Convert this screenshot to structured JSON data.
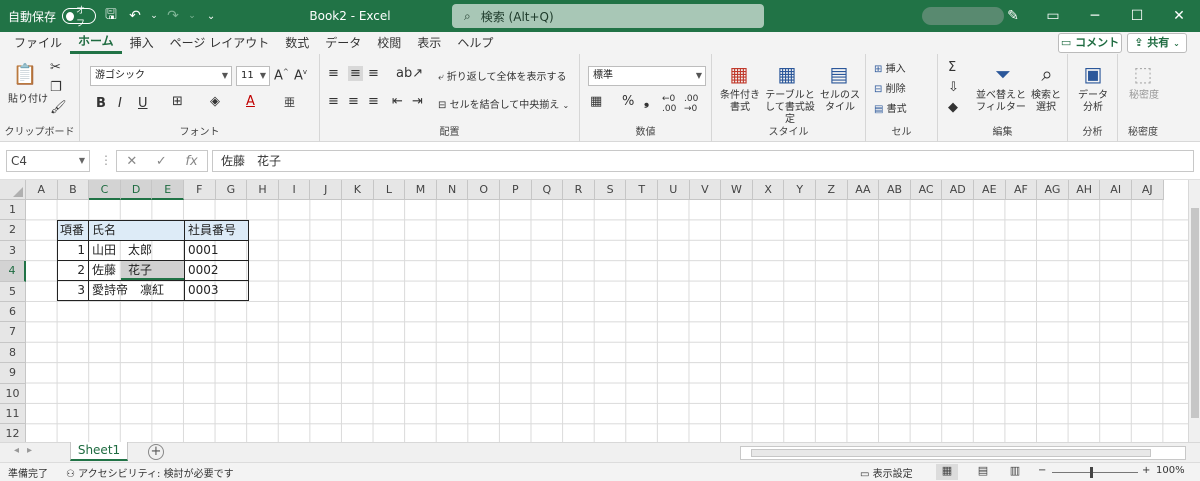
{
  "titlebar": {
    "autosave_label": "自動保存",
    "autosave_state": "オフ",
    "doc_title": "Book2  -  Excel",
    "search_label": "検索 (Alt+Q)"
  },
  "menu": {
    "tabs": [
      "ファイル",
      "ホーム",
      "挿入",
      "ページ レイアウト",
      "数式",
      "データ",
      "校閲",
      "表示",
      "ヘルプ"
    ],
    "active_tab": "ホーム",
    "comment_label": "コメント",
    "share_label": "共有"
  },
  "ribbon": {
    "clipboard": {
      "label": "クリップボード",
      "paste": "貼り付け"
    },
    "font": {
      "label": "フォント",
      "name": "游ゴシック",
      "size": "11",
      "bold": "B",
      "italic": "I",
      "underline": "U"
    },
    "alignment": {
      "label": "配置",
      "wrap": "折り返して全体を表示する",
      "merge": "セルを結合して中央揃え"
    },
    "number": {
      "label": "数値",
      "format": "標準"
    },
    "styles": {
      "label": "スタイル",
      "conditional": "条件付き書式",
      "table": "テーブルとして書式設定",
      "cell": "セルのスタイル"
    },
    "cells": {
      "label": "セル",
      "insert": "挿入",
      "delete": "削除",
      "format": "書式"
    },
    "editing": {
      "label": "編集",
      "sort": "並べ替えとフィルター",
      "find": "検索と選択"
    },
    "analysis": {
      "label": "分析",
      "data_analysis": "データ分析"
    },
    "sensitivity": {
      "label": "秘密度",
      "button": "秘密度"
    }
  },
  "formula_bar": {
    "name_box": "C4",
    "content": "佐藤　花子"
  },
  "grid": {
    "columns": [
      "A",
      "B",
      "C",
      "D",
      "E",
      "F",
      "G",
      "H",
      "I",
      "J",
      "K",
      "L",
      "M",
      "N",
      "O",
      "P",
      "Q",
      "R",
      "S",
      "T",
      "U",
      "V",
      "W",
      "X",
      "Y",
      "Z",
      "AA",
      "AB",
      "AC",
      "AD",
      "AE",
      "AF",
      "AG",
      "AH",
      "AI",
      "AJ"
    ],
    "rows": [
      "1",
      "2",
      "3",
      "4",
      "5",
      "6",
      "7",
      "8",
      "9",
      "10",
      "11",
      "12"
    ],
    "table": {
      "headers": [
        "項番",
        "氏名",
        "社員番号"
      ],
      "rows": [
        [
          "1",
          "山田　太郎",
          "0001"
        ],
        [
          "2",
          "佐藤　花子",
          "0002"
        ],
        [
          "3",
          "愛詩帝　凛紅",
          "0003"
        ]
      ]
    }
  },
  "sheets": {
    "active": "Sheet1"
  },
  "status": {
    "ready": "準備完了",
    "accessibility": "アクセシビリティ: 検討が必要です",
    "display_settings": "表示設定",
    "zoom": "100%"
  }
}
